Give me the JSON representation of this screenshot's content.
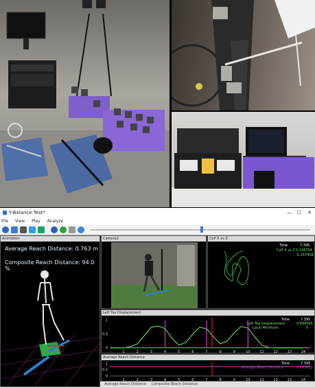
{
  "window": {
    "title": "Y-Balance Test*",
    "controls": [
      "—",
      "☐",
      "✕"
    ]
  },
  "menu": [
    "File",
    "View",
    "Play",
    "Analyze"
  ],
  "toolbar_icons": [
    "info-icon",
    "open-icon",
    "save-icon",
    "export-icon",
    "chart-icon",
    "refresh-icon",
    "play-icon",
    "pause-icon",
    "record-icon"
  ],
  "animation_panel": {
    "title": "Animation",
    "avg_reach_label": "Average Reach Distance: 0.763 m",
    "composite_label": "Composite Reach Distance: 94.0 %"
  },
  "camera_panel": {
    "title": "Camera2"
  },
  "cop_panel": {
    "title": "CoP X vs Z",
    "time_label": "Time",
    "time_value": "7.395",
    "row1_label": "CoP X vs Z",
    "row1_value1": "0.126754",
    "row1_value2": "-0.257458"
  },
  "toe_panel": {
    "title": "Left Toe Displacement",
    "time_label": "Time",
    "time_value": "7.395",
    "row1_label": "Left Toe Displacement",
    "row1_value": "0.699595",
    "row2_label": "Local Minimum",
    "row2_value": "0",
    "y_ticks": [
      "1",
      "0.5",
      "0"
    ],
    "x_ticks": [
      "1",
      "2",
      "3",
      "4",
      "5",
      "6",
      "7",
      "8",
      "9",
      "10",
      "11",
      "12",
      "13",
      "14"
    ]
  },
  "reach_panel": {
    "title": "Average Reach Distance",
    "time_label": "Time",
    "time_value": "7.395",
    "row1_label": "Average Reach Distance",
    "row1_value": "0.763022",
    "y_ticks": [
      "1",
      "0.5",
      "0"
    ],
    "x_ticks": [
      "1",
      "2",
      "3",
      "4",
      "5",
      "6",
      "7",
      "8",
      "9",
      "10",
      "11",
      "12",
      "13",
      "14"
    ]
  },
  "bottom_tabs": [
    "Average Reach Distance",
    "Composite Reach Distance"
  ],
  "chart_data": [
    {
      "type": "line",
      "title": "Left Toe Displacement",
      "x": [
        0,
        0.5,
        1,
        1.5,
        2,
        2.5,
        3,
        3.5,
        4,
        4.5,
        5,
        5.5,
        6,
        6.5,
        7,
        7.5,
        8,
        8.5,
        9,
        9.5,
        10,
        10.5,
        11,
        11.5,
        12,
        12.5,
        13,
        13.5,
        14
      ],
      "y": [
        0,
        0,
        0,
        0.05,
        0.15,
        0.45,
        0.75,
        0.8,
        0.7,
        0.35,
        0.1,
        0.2,
        0.5,
        0.75,
        0.7,
        0.4,
        0.15,
        0.25,
        0.55,
        0.78,
        0.72,
        0.4,
        0.1,
        0.02,
        0,
        0,
        0,
        0,
        0
      ],
      "xlim": [
        0,
        14.5
      ],
      "ylim": [
        0,
        1.1
      ],
      "markers_x": [
        4,
        7,
        10
      ],
      "cursor_x": 7.4
    },
    {
      "type": "line",
      "title": "Average Reach Distance",
      "x": [
        0,
        14.5
      ],
      "y": [
        0.76,
        0.76
      ],
      "xlim": [
        0,
        14.5
      ],
      "ylim": [
        0,
        1.1
      ],
      "cursor_x": 7.4
    }
  ]
}
